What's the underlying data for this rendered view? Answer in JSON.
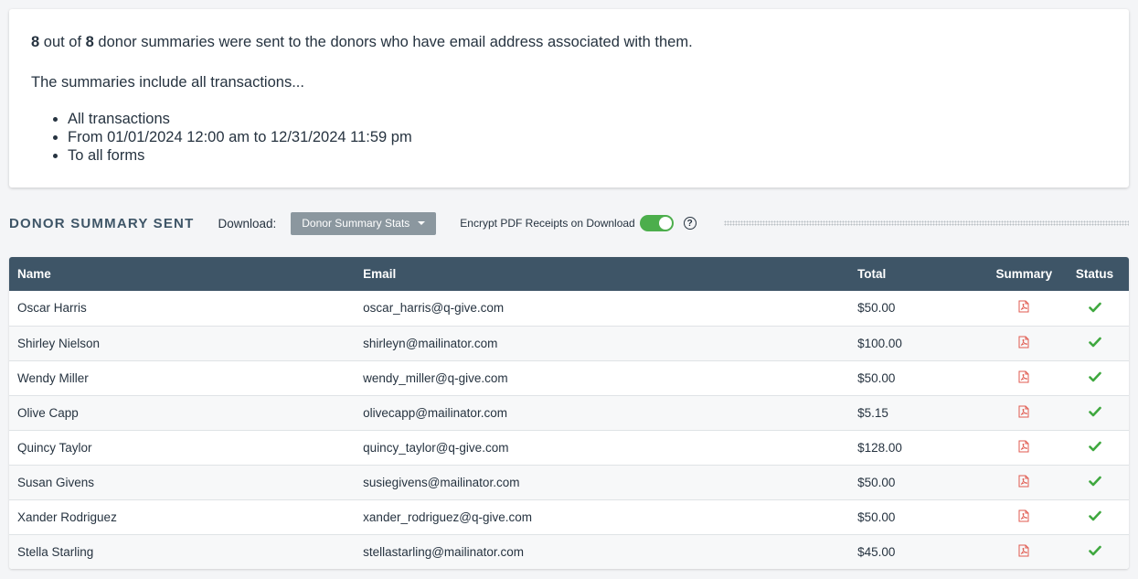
{
  "summary": {
    "sent_count": "8",
    "sent_mid": " out of ",
    "total_count": "8",
    "sent_tail": " donor summaries were sent to the donors who have email address associated with them.",
    "include_text": "The summaries include all transactions...",
    "criteria": [
      "All transactions",
      "From 01/01/2024 12:00 am to 12/31/2024 11:59 pm",
      "To all forms"
    ]
  },
  "toolbar": {
    "title": "DONOR SUMMARY SENT",
    "download_label": "Download:",
    "download_button": "Donor Summary Stats",
    "encrypt_label": "Encrypt PDF Receipts on Download",
    "encrypt_enabled": true,
    "help_glyph": "?"
  },
  "colors": {
    "header_bg": "#3e5567",
    "toggle_on": "#4cae4c",
    "pdf_icon": "#e05a4f",
    "check": "#3fa83f"
  },
  "table": {
    "columns": {
      "name": "Name",
      "email": "Email",
      "total": "Total",
      "summary": "Summary",
      "status": "Status"
    },
    "rows": [
      {
        "name": "Oscar Harris",
        "email": "oscar_harris@q-give.com",
        "total": "$50.00",
        "summary_icon": "pdf-icon",
        "status_icon": "check-icon"
      },
      {
        "name": "Shirley Nielson",
        "email": "shirleyn@mailinator.com",
        "total": "$100.00",
        "summary_icon": "pdf-icon",
        "status_icon": "check-icon"
      },
      {
        "name": "Wendy Miller",
        "email": "wendy_miller@q-give.com",
        "total": "$50.00",
        "summary_icon": "pdf-icon",
        "status_icon": "check-icon"
      },
      {
        "name": "Olive Capp",
        "email": "olivecapp@mailinator.com",
        "total": "$5.15",
        "summary_icon": "pdf-icon",
        "status_icon": "check-icon"
      },
      {
        "name": "Quincy Taylor",
        "email": "quincy_taylor@q-give.com",
        "total": "$128.00",
        "summary_icon": "pdf-icon",
        "status_icon": "check-icon"
      },
      {
        "name": "Susan Givens",
        "email": "susiegivens@mailinator.com",
        "total": "$50.00",
        "summary_icon": "pdf-icon",
        "status_icon": "check-icon"
      },
      {
        "name": "Xander Rodriguez",
        "email": "xander_rodriguez@q-give.com",
        "total": "$50.00",
        "summary_icon": "pdf-icon",
        "status_icon": "check-icon"
      },
      {
        "name": "Stella Starling",
        "email": "stellastarling@mailinator.com",
        "total": "$45.00",
        "summary_icon": "pdf-icon",
        "status_icon": "check-icon"
      }
    ]
  }
}
